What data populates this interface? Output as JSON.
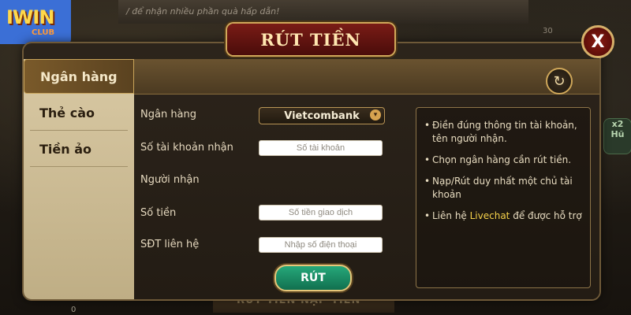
{
  "background": {
    "banner_text": "/ để nhận nhiều phần quà hấp dẫn!",
    "corner_number": "30",
    "bottom_text": "RÚT TIỀN   NẠP TIỀN",
    "right_badge_top": "x2",
    "right_badge_bottom": "Hũ",
    "coin_value": "0"
  },
  "logo": {
    "brand": "IWIN",
    "sub": "CLUB"
  },
  "dialog": {
    "title": "RÚT TIỀN",
    "close_label": "X",
    "history_icon": "history-icon"
  },
  "sidebar": {
    "items": [
      {
        "label": "Ngân hàng",
        "active": true
      },
      {
        "label": "Thẻ cào",
        "active": false
      },
      {
        "label": "Tiền ảo",
        "active": false
      }
    ]
  },
  "form": {
    "bank_label": "Ngân hàng",
    "bank_value": "Vietcombank",
    "account_label": "Số tài khoản nhận",
    "account_placeholder": "Số tài khoản",
    "recipient_label": "Người nhận",
    "amount_label": "Số tiền",
    "amount_placeholder": "Số tiền giao dịch",
    "phone_label": "SĐT liên hệ",
    "phone_placeholder": "Nhập số điện thoại",
    "submit_label": "RÚT"
  },
  "info": {
    "items": [
      "Điền đúng thông tin tài khoản, tên người nhận.",
      "Chọn ngân hàng cần rút tiền.",
      "Nạp/Rút duy nhất một chủ tài khoản"
    ],
    "contact_prefix": "Liên hệ ",
    "contact_link": "Livechat",
    "contact_suffix": " để được hỗ trợ"
  }
}
